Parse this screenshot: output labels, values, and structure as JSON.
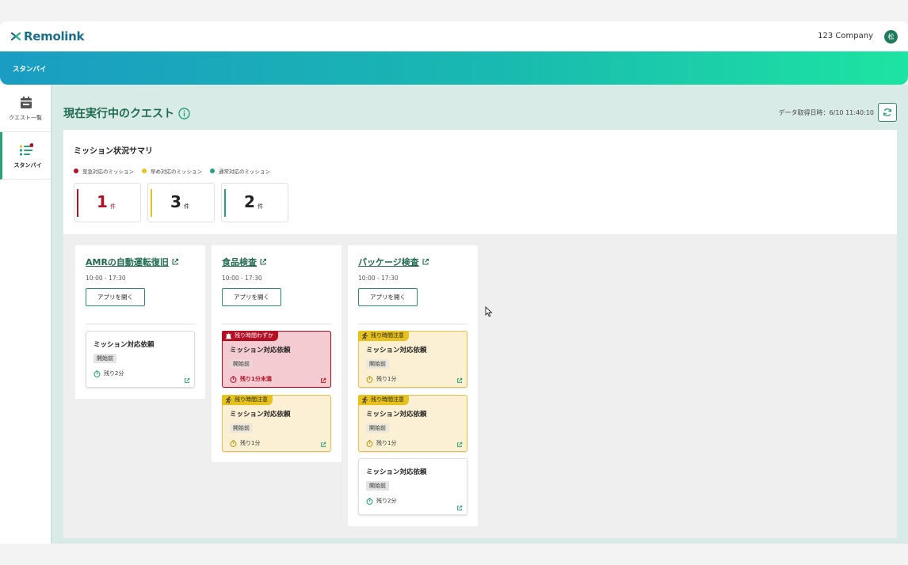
{
  "header": {
    "brand": "Remolink",
    "company": "123 Company",
    "avatar_initial": "松"
  },
  "banner": {
    "title": "スタンバイ"
  },
  "sidebar": {
    "items": [
      {
        "label": "クエスト一覧",
        "icon": "calendar-icon",
        "active": false
      },
      {
        "label": "スタンバイ",
        "icon": "standby-list-icon",
        "active": true
      }
    ]
  },
  "main": {
    "title": "現在実行中のクエスト",
    "fetched_at": "データ取得日時：6/10 11:40:10"
  },
  "summary": {
    "title": "ミッション状況サマリ",
    "legend": [
      {
        "label": "至急対応のミッション",
        "color": "#b30f25"
      },
      {
        "label": "早め対応のミッション",
        "color": "#e7c21d"
      },
      {
        "label": "通常対応のミッション",
        "color": "#27a17a"
      }
    ],
    "counts": [
      {
        "value": "1",
        "unit": "件",
        "color": "#b30f25"
      },
      {
        "value": "3",
        "unit": "件",
        "color": "#e7c21d"
      },
      {
        "value": "2",
        "unit": "件",
        "color": "#27a17a"
      }
    ]
  },
  "quests": [
    {
      "name": "AMRの自動運転復旧",
      "time": "10:00 - 17:30",
      "open_label": "アプリを開く",
      "missions": [
        {
          "title": "ミッション対応依頼",
          "status": "開始前",
          "remaining": "残り2分",
          "level": "normal"
        }
      ]
    },
    {
      "name": "食品検査",
      "time": "10:00 - 17:30",
      "open_label": "アプリを開く",
      "missions": [
        {
          "badge": "残り時間わずか",
          "title": "ミッション対応依頼",
          "status": "開始前",
          "remaining": "残り1分未満",
          "level": "urgent"
        },
        {
          "badge": "残り時間注意",
          "title": "ミッション対応依頼",
          "status": "開始前",
          "remaining": "残り1分",
          "level": "caution"
        }
      ]
    },
    {
      "name": "パッケージ検査",
      "time": "10:00 - 17:30",
      "open_label": "アプリを開く",
      "missions": [
        {
          "badge": "残り時間注意",
          "title": "ミッション対応依頼",
          "status": "開始前",
          "remaining": "残り1分",
          "level": "caution"
        },
        {
          "badge": "残り時間注意",
          "title": "ミッション対応依頼",
          "status": "開始前",
          "remaining": "残り1分",
          "level": "caution"
        },
        {
          "title": "ミッション対応依頼",
          "status": "開始前",
          "remaining": "残り2分",
          "level": "normal"
        }
      ]
    }
  ]
}
